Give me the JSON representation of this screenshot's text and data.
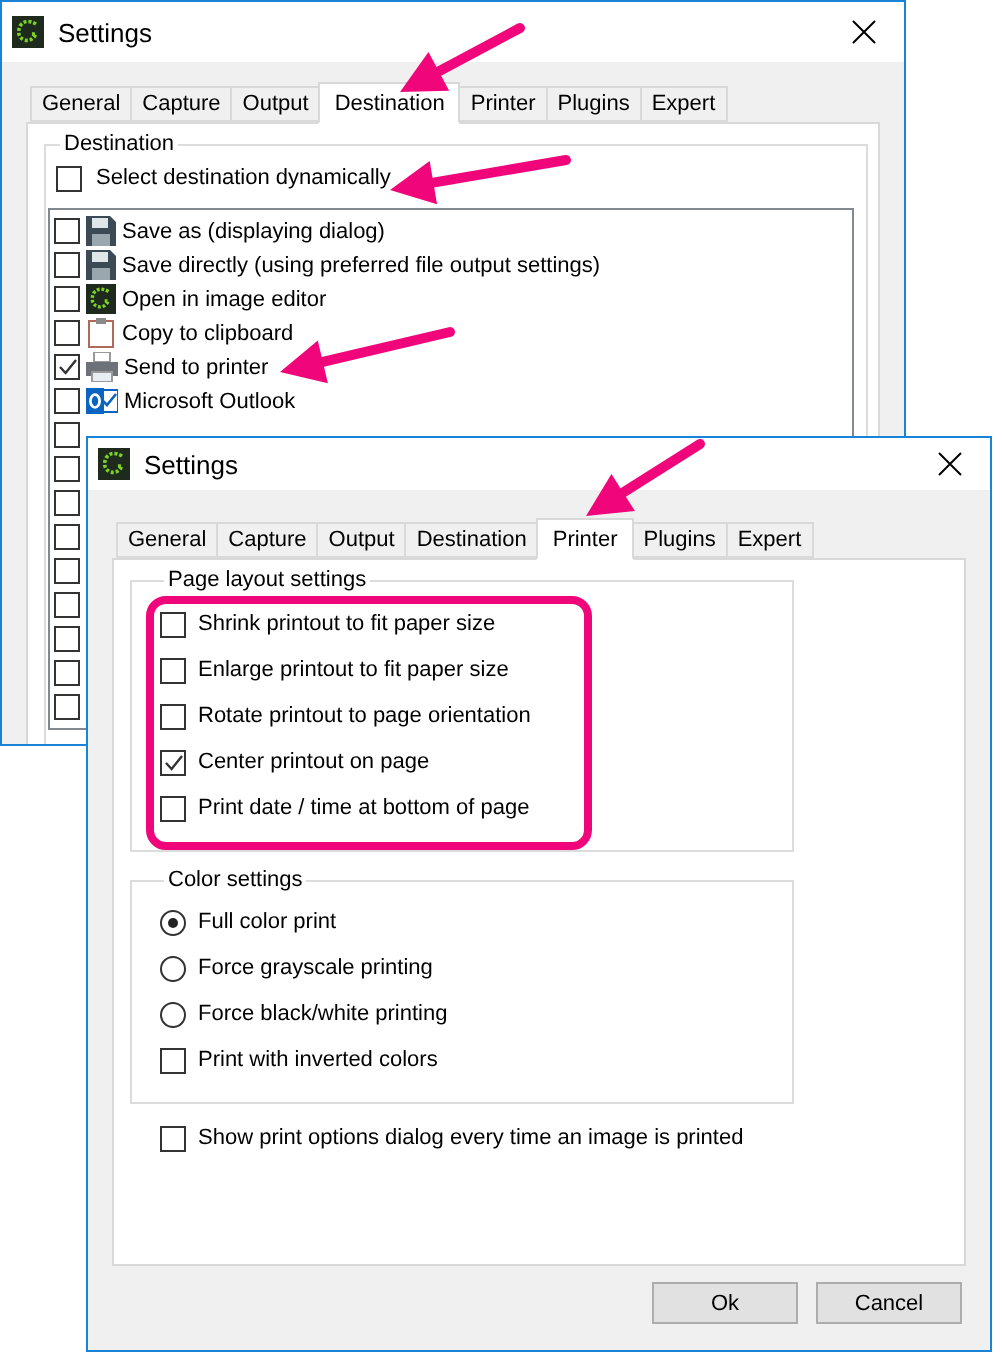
{
  "back_window": {
    "title": "Settings",
    "tabs": [
      {
        "label": "General",
        "selected": false
      },
      {
        "label": "Capture",
        "selected": false
      },
      {
        "label": "Output",
        "selected": false
      },
      {
        "label": "Destination",
        "selected": true
      },
      {
        "label": "Printer",
        "selected": false
      },
      {
        "label": "Plugins",
        "selected": false
      },
      {
        "label": "Expert",
        "selected": false
      }
    ],
    "group_label": "Destination",
    "select_dynamically": {
      "label": "Select destination dynamically",
      "checked": false
    },
    "destinations": [
      {
        "label": "Save as (displaying dialog)",
        "checked": false
      },
      {
        "label": "Save directly (using preferred file output settings)",
        "checked": false
      },
      {
        "label": "Open in image editor",
        "checked": false
      },
      {
        "label": "Copy to clipboard",
        "checked": false
      },
      {
        "label": "Send to printer",
        "checked": true
      },
      {
        "label": "Microsoft Outlook",
        "checked": false
      },
      {
        "checked": false
      },
      {
        "checked": false
      },
      {
        "checked": false
      },
      {
        "checked": false
      },
      {
        "checked": false
      },
      {
        "checked": false
      },
      {
        "checked": false
      },
      {
        "checked": false
      },
      {
        "checked": false
      }
    ]
  },
  "front_window": {
    "title": "Settings",
    "tabs": [
      {
        "label": "General",
        "selected": false
      },
      {
        "label": "Capture",
        "selected": false
      },
      {
        "label": "Output",
        "selected": false
      },
      {
        "label": "Destination",
        "selected": false
      },
      {
        "label": "Printer",
        "selected": true
      },
      {
        "label": "Plugins",
        "selected": false
      },
      {
        "label": "Expert",
        "selected": false
      }
    ],
    "page_layout": {
      "label": "Page layout settings",
      "options": [
        {
          "label": "Shrink printout to fit paper size",
          "checked": false
        },
        {
          "label": "Enlarge printout to fit paper size",
          "checked": false
        },
        {
          "label": "Rotate printout to page orientation",
          "checked": false
        },
        {
          "label": "Center printout on page",
          "checked": true
        },
        {
          "label": "Print date / time at bottom of page",
          "checked": false
        }
      ]
    },
    "color_settings": {
      "label": "Color settings",
      "options": [
        {
          "kind": "radio",
          "label": "Full color print",
          "selected": true
        },
        {
          "kind": "radio",
          "label": "Force grayscale printing",
          "selected": false
        },
        {
          "kind": "radio",
          "label": "Force black/white printing",
          "selected": false
        },
        {
          "kind": "checkbox",
          "label": "Print with inverted colors",
          "checked": false
        }
      ]
    },
    "show_dialog": {
      "label": "Show print options dialog every time an image is printed",
      "checked": false
    },
    "buttons": [
      "Ok",
      "Cancel"
    ]
  }
}
